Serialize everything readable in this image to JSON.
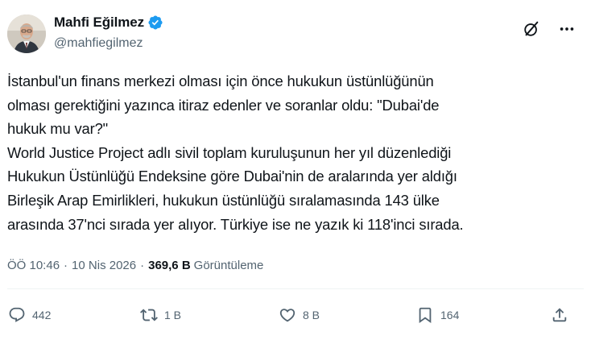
{
  "author": {
    "name": "Mahfi Eğilmez",
    "handle": "@mahfiegilmez",
    "verified": true,
    "verified_color": "#1d9bf0"
  },
  "header_icons": [
    "grok-icon",
    "more-icon"
  ],
  "tweet": {
    "text": "İstanbul'un finans merkezi olması için önce hukukun üstünlüğünün\nolması gerektiğini yazınca itiraz edenler ve soranlar oldu: \"Dubai'de\nhukuk mu var?\"\nWorld Justice Project adlı sivil toplam kuruluşunun her yıl düzenlediği\nHukukun Üstünlüğü Endeksine göre Dubai'nin de aralarında yer aldığı\nBirleşik Arap Emirlikleri, hukukun üstünlüğü sıralamasında 143 ülke\narasında 37'nci sırada yer alıyor. Türkiye ise ne yazık ki 118'inci sırada."
  },
  "meta": {
    "time": "ÖÖ 10:46",
    "date": "10 Nis 2026",
    "views_count": "369,6 B",
    "views_label": "Görüntüleme",
    "separator": "·"
  },
  "actions": {
    "reply_count": "442",
    "retweet_count": "1 B",
    "like_count": "8 B",
    "bookmark_count": "164"
  },
  "colors": {
    "text": "#0f1419",
    "secondary": "#536471",
    "divider": "#eff3f4",
    "accent": "#1d9bf0"
  }
}
